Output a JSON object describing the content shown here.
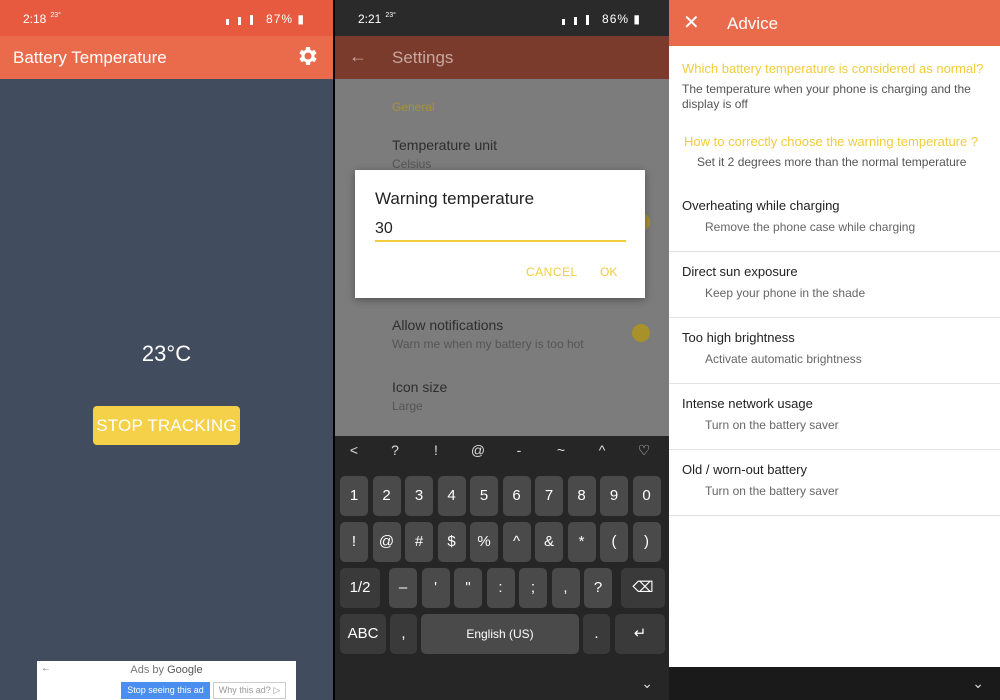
{
  "panel1": {
    "status": {
      "time": "2:18",
      "temp": "23°",
      "battery": "87%"
    },
    "app_title": "Battery Temperature",
    "temperature": "23°C",
    "stop_button": "STOP TRACKING",
    "ad": {
      "byline_prefix": "Ads by ",
      "byline_brand": "Google",
      "stop": "Stop seeing this ad",
      "why": "Why this ad?"
    }
  },
  "panel2": {
    "status": {
      "time": "2:21",
      "temp": "23°",
      "battery": "86%"
    },
    "title": "Settings",
    "section": "General",
    "settings": [
      {
        "title": "Temperature unit",
        "subtitle": "Celsius"
      },
      {
        "title": "Allow notifications",
        "subtitle": "Warn me when my battery is too hot"
      },
      {
        "title": "Icon size",
        "subtitle": "Large"
      }
    ],
    "dialog": {
      "title": "Warning temperature",
      "value": "30",
      "cancel": "CANCEL",
      "ok": "OK"
    },
    "keyboard": {
      "toolbar": [
        "<",
        "?",
        "!",
        "@",
        "-",
        "~",
        "^",
        "♡"
      ],
      "row1": [
        "1",
        "2",
        "3",
        "4",
        "5",
        "6",
        "7",
        "8",
        "9",
        "0"
      ],
      "row2": [
        "!",
        "@",
        "#",
        "$",
        "%",
        "^",
        "&",
        "*",
        "(",
        ")"
      ],
      "row3_mode": "1/2",
      "row3": [
        "–",
        "'",
        "\"",
        ":",
        ";",
        ",",
        "?"
      ],
      "row4_mode": "ABC",
      "row4_comma": ",",
      "space": "English (US)",
      "row4_dot": "."
    }
  },
  "panel3": {
    "title": "Advice",
    "q1": "Which battery temperature is considered as normal?",
    "a1_line1": "The temperature when your phone is charging and the",
    "a1_line2": "display is off",
    "q2": "How to correctly choose the warning temperature ?",
    "a2": "Set it 2 degrees more than the normal temperature",
    "tips": [
      {
        "title": "Overheating while charging",
        "subtitle": "Remove the phone case while charging"
      },
      {
        "title": "Direct sun exposure",
        "subtitle": "Keep your phone in the shade"
      },
      {
        "title": "Too high brightness",
        "subtitle": "Activate automatic brightness"
      },
      {
        "title": "Intense network usage",
        "subtitle": "Turn on the battery saver"
      },
      {
        "title": "Old / worn-out battery",
        "subtitle": "Turn on the battery saver"
      }
    ]
  },
  "colors": {
    "accent": "#ea6a4c",
    "button_yellow": "#f5d14a",
    "dark_bg": "#424c5f"
  }
}
